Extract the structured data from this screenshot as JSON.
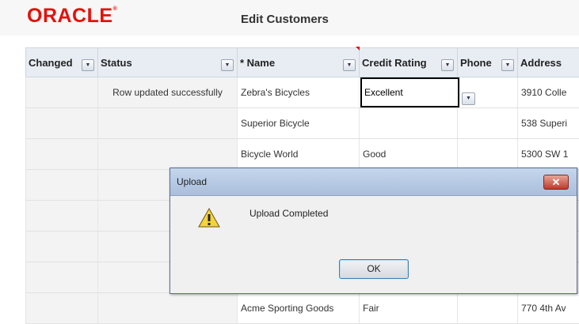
{
  "header": {
    "logo": "ORACLE",
    "logo_mark": "®",
    "title": "Edit Customers"
  },
  "table": {
    "columns": [
      {
        "label": "Changed"
      },
      {
        "label": "Status"
      },
      {
        "label": "* Name"
      },
      {
        "label": "Credit Rating"
      },
      {
        "label": "Phone"
      },
      {
        "label": "Address"
      }
    ],
    "rows": [
      {
        "status": "Row updated successfully",
        "name": "Zebra's Bicycles",
        "credit": "Excellent",
        "phone": "",
        "address": "3910 Colle"
      },
      {
        "status": "",
        "name": "Superior Bicycle",
        "credit": "",
        "phone": "",
        "address": "538 Superi"
      },
      {
        "status": "",
        "name": "Bicycle World",
        "credit": "Good",
        "phone": "",
        "address": "5300 SW 1"
      },
      {
        "status": "",
        "name": "",
        "credit": "",
        "phone": "",
        "address": ""
      },
      {
        "status": "",
        "name": "",
        "credit": "",
        "phone": "",
        "address": ""
      },
      {
        "status": "",
        "name": "",
        "credit": "",
        "phone": "",
        "address": ""
      },
      {
        "status": "",
        "name": "",
        "credit": "",
        "phone": "",
        "address": ""
      },
      {
        "status": "",
        "name": "Acme Sporting Goods",
        "credit": "Fair",
        "phone": "",
        "address": "770 4th Av"
      }
    ]
  },
  "dialog": {
    "title": "Upload",
    "message": "Upload Completed",
    "ok_label": "OK",
    "icon": "warning-icon"
  }
}
